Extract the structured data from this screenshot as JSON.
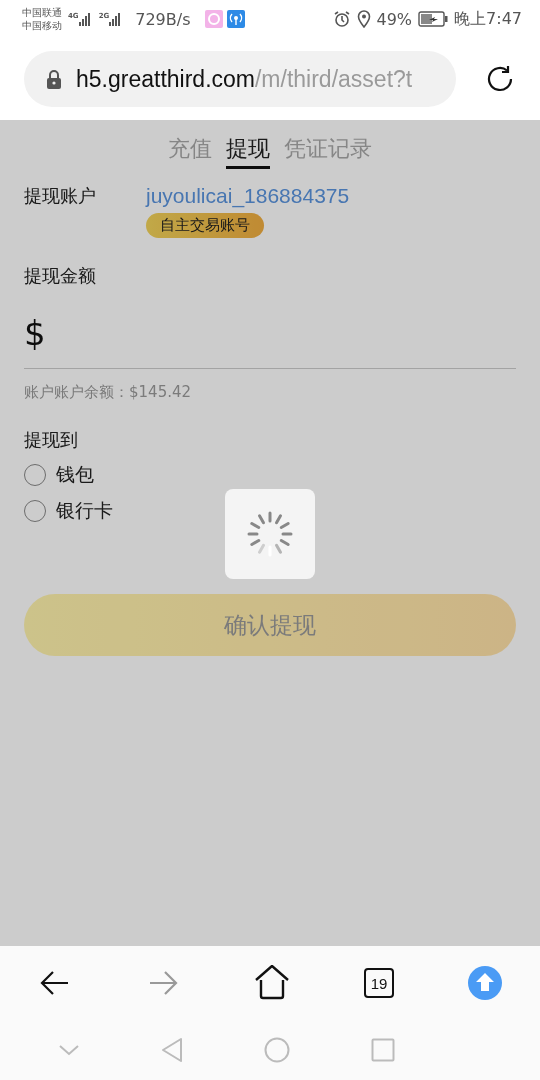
{
  "status_bar": {
    "carriers": [
      "中国联通",
      "中国移动"
    ],
    "networks": [
      {
        "type": "4G"
      },
      {
        "type": "2G"
      }
    ],
    "net_speed": "729B/s",
    "battery": "49%",
    "time": "晚上7:47"
  },
  "browser": {
    "url_host": "h5.greatthird.com",
    "url_path": "/m/third/asset?t"
  },
  "tabs": [
    {
      "label": "充值",
      "selected": false
    },
    {
      "label": "提现",
      "selected": true
    },
    {
      "label": "凭证记录",
      "selected": false
    }
  ],
  "account": {
    "label": "提现账户",
    "value": "juyoulicai_186884375",
    "badge": "自主交易账号"
  },
  "amount": {
    "label": "提现金额",
    "currency": "$"
  },
  "balance": "账户账户余额：$145.42",
  "withdraw_to": {
    "label": "提现到",
    "options": [
      {
        "label": "钱包",
        "selected": false
      },
      {
        "label": "银行卡",
        "selected": false
      }
    ]
  },
  "submit": "确认提现",
  "loading": true,
  "toolbar": {
    "back_enabled": true,
    "forward_enabled": false,
    "tab_count": "19"
  }
}
